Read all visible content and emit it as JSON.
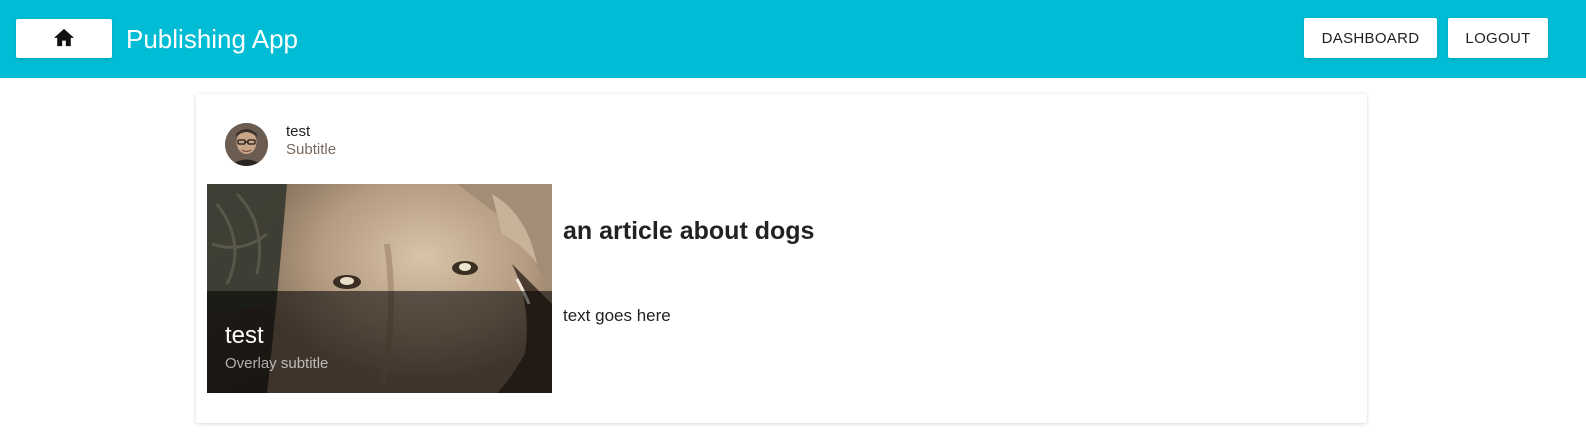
{
  "appbar": {
    "title": "Publishing App",
    "home_icon": "home-icon",
    "dashboard_label": "DASHBOARD",
    "logout_label": "LOGOUT",
    "bg_color": "#00bcd4"
  },
  "card": {
    "header": {
      "avatar": "avatar-image",
      "title": "test",
      "subtitle": "Subtitle"
    },
    "media": {
      "image": "dog-photo",
      "overlay_title": "test",
      "overlay_subtitle": "Overlay subtitle"
    },
    "article_title": "an article about dogs",
    "article_text": "text goes here"
  }
}
